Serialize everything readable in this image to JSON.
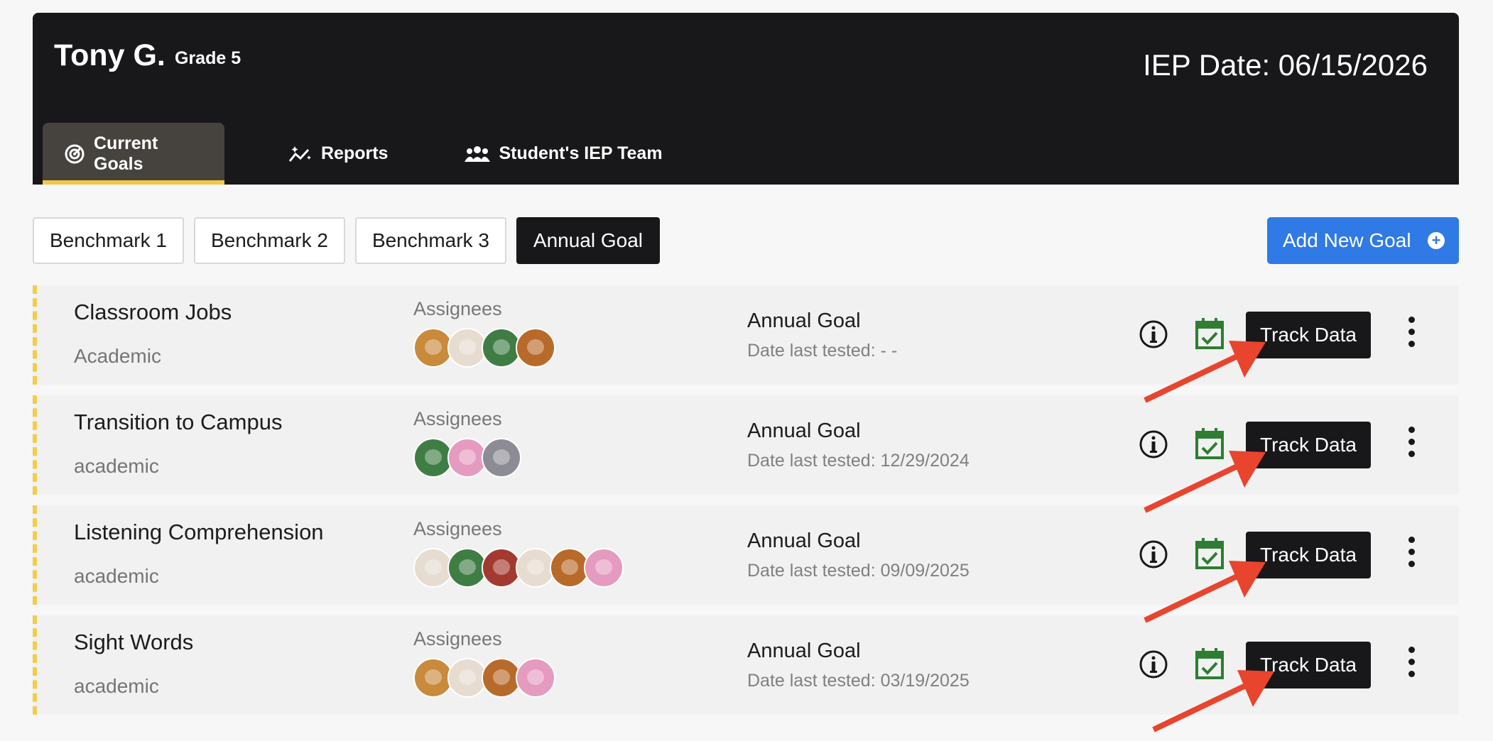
{
  "student": {
    "name": "Tony G.",
    "grade": "Grade 5",
    "iep_date": "IEP Date: 06/15/2026"
  },
  "tabs": [
    {
      "label": "Current Goals",
      "icon": "target-icon",
      "active": true
    },
    {
      "label": "Reports",
      "icon": "sparkle-chart-icon",
      "active": false
    },
    {
      "label": "Student's IEP Team",
      "icon": "team-icon",
      "active": false
    }
  ],
  "filters": [
    {
      "label": "Benchmark 1",
      "active": false
    },
    {
      "label": "Benchmark 2",
      "active": false
    },
    {
      "label": "Benchmark 3",
      "active": false
    },
    {
      "label": "Annual Goal",
      "active": true
    }
  ],
  "add_goal_label": "Add New Goal",
  "assignees_label": "Assignees",
  "track_label": "Track Data",
  "colors": {
    "header": "#18181b",
    "active_tab_underline": "#f2c744",
    "add_button": "#2f7ae5",
    "calendar_check": "#2e7d32",
    "annotation_arrow": "#e8442e"
  },
  "goals": [
    {
      "title": "Classroom Jobs",
      "category": "Academic",
      "type": "Annual Goal",
      "last_tested": "Date last tested: - -",
      "avatars": [
        "lion",
        "eagle",
        "frog",
        "tiger"
      ]
    },
    {
      "title": "Transition to Campus",
      "category": "academic",
      "type": "Annual Goal",
      "last_tested": "Date last tested: 12/29/2024",
      "avatars": [
        "frog",
        "flamingo",
        "elephant"
      ]
    },
    {
      "title": "Listening Comprehension",
      "category": "academic",
      "type": "Annual Goal",
      "last_tested": "Date last tested: 09/09/2025",
      "avatars": [
        "eagle",
        "frog",
        "raccoon",
        "eagle",
        "tiger",
        "flamingo"
      ]
    },
    {
      "title": "Sight Words",
      "category": "academic",
      "type": "Annual Goal",
      "last_tested": "Date last tested: 03/19/2025",
      "avatars": [
        "lion",
        "eagle",
        "tiger",
        "flamingo"
      ]
    }
  ]
}
